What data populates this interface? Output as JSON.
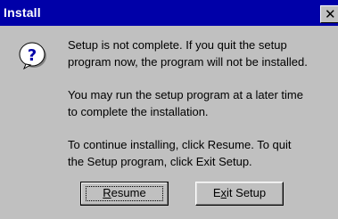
{
  "window": {
    "title": "Install",
    "close_glyph": "✕"
  },
  "icon": "question-icon",
  "messages": {
    "line1": "Setup is not complete.  If you quit the setup",
    "line2": "program now, the program will not be installed.",
    "line3": "You may run the setup program at a later time",
    "line4": "to complete the installation.",
    "line5": "To continue installing, click Resume.  To quit",
    "line6": "the Setup program, click Exit Setup."
  },
  "buttons": {
    "resume": {
      "mnemonic": "R",
      "rest": "esume"
    },
    "exit": {
      "prefix": "E",
      "mnemonic": "x",
      "rest": "it Setup"
    }
  },
  "colors": {
    "titlebar": "#0000a8",
    "dialog": "#c0c0c0",
    "icon_fill": "#ffffff",
    "icon_glyph": "#0000a8"
  }
}
